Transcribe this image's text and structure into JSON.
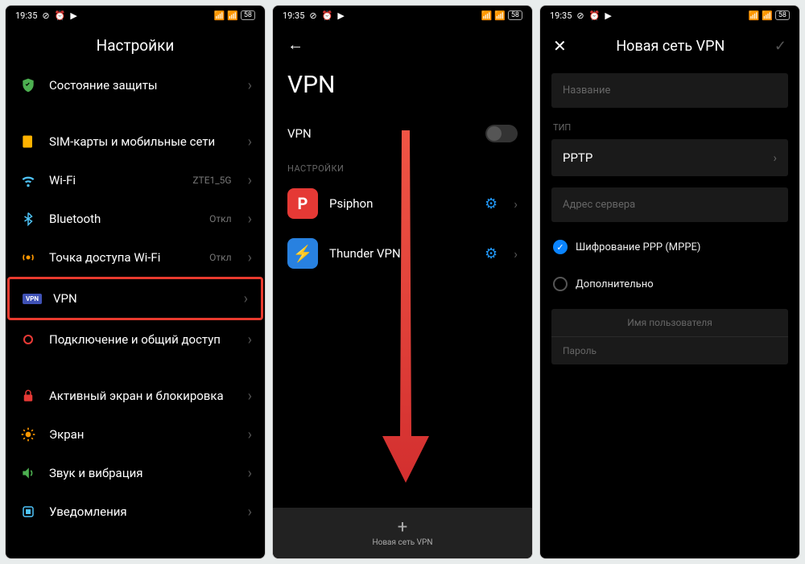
{
  "status": {
    "time": "19:35",
    "battery": "58"
  },
  "screen1": {
    "title": "Настройки",
    "items": [
      {
        "label": "Состояние защиты",
        "trailing": ""
      },
      {
        "label": "SIM-карты и мобильные сети",
        "trailing": ""
      },
      {
        "label": "Wi-Fi",
        "trailing": "ZTE1_5G"
      },
      {
        "label": "Bluetooth",
        "trailing": "Откл"
      },
      {
        "label": "Точка доступа Wi-Fi",
        "trailing": "Откл"
      },
      {
        "label": "VPN",
        "trailing": ""
      },
      {
        "label": "Подключение и общий доступ",
        "trailing": ""
      },
      {
        "label": "Активный экран и блокировка",
        "trailing": ""
      },
      {
        "label": "Экран",
        "trailing": ""
      },
      {
        "label": "Звук и вибрация",
        "trailing": ""
      },
      {
        "label": "Уведомления",
        "trailing": ""
      }
    ]
  },
  "screen2": {
    "title": "VPN",
    "toggle_label": "VPN",
    "section_label": "НАСТРОЙКИ",
    "apps": [
      {
        "name": "Psiphon"
      },
      {
        "name": "Thunder VPN"
      }
    ],
    "add_label": "Новая сеть VPN"
  },
  "screen3": {
    "title": "Новая сеть VPN",
    "name_placeholder": "Название",
    "type_label": "ТИП",
    "type_value": "PPTP",
    "server_placeholder": "Адрес сервера",
    "encryption_label": "Шифрование PPP (MPPE)",
    "advanced_label": "Дополнительно",
    "username_placeholder": "Имя пользователя",
    "password_placeholder": "Пароль"
  }
}
